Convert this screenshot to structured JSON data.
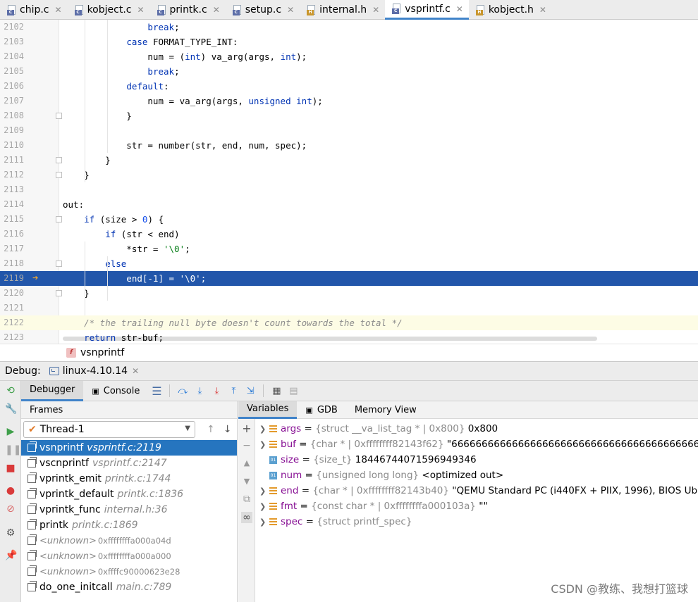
{
  "tabs": [
    {
      "label": "chip.c",
      "kind": "c"
    },
    {
      "label": "kobject.c",
      "kind": "c"
    },
    {
      "label": "printk.c",
      "kind": "c"
    },
    {
      "label": "setup.c",
      "kind": "c"
    },
    {
      "label": "internal.h",
      "kind": "h"
    },
    {
      "label": "vsprintf.c",
      "kind": "c",
      "active": true
    },
    {
      "label": "kobject.h",
      "kind": "h"
    }
  ],
  "code_lines": [
    {
      "num": "2102",
      "text": "                break;"
    },
    {
      "num": "2103",
      "text": "            case FORMAT_TYPE_INT:"
    },
    {
      "num": "2104",
      "text": "                num = (int) va_arg(args, int);"
    },
    {
      "num": "2105",
      "text": "                break;"
    },
    {
      "num": "2106",
      "text": "            default:"
    },
    {
      "num": "2107",
      "text": "                num = va_arg(args, unsigned int);"
    },
    {
      "num": "2108",
      "text": "            }"
    },
    {
      "num": "2109",
      "text": ""
    },
    {
      "num": "2110",
      "text": "            str = number(str, end, num, spec);"
    },
    {
      "num": "2111",
      "text": "        }"
    },
    {
      "num": "2112",
      "text": "    }"
    },
    {
      "num": "2113",
      "text": ""
    },
    {
      "num": "2114",
      "text": "out:"
    },
    {
      "num": "2115",
      "text": "    if (size > 0) {"
    },
    {
      "num": "2116",
      "text": "        if (str < end)"
    },
    {
      "num": "2117",
      "text": "            *str = '\\0';"
    },
    {
      "num": "2118",
      "text": "        else"
    },
    {
      "num": "2119",
      "text": "            end[-1] = '\\0';"
    },
    {
      "num": "2120",
      "text": "    }"
    },
    {
      "num": "2121",
      "text": ""
    },
    {
      "num": "2122",
      "text": "    /* the trailing null byte doesn't count towards the total */"
    },
    {
      "num": "2123",
      "text": "    return str-buf;"
    }
  ],
  "breadcrumb": {
    "function": "vsnprintf",
    "badge": "f"
  },
  "debug": {
    "label": "Debug:",
    "session": "linux-4.10.14",
    "tabs": {
      "debugger": "Debugger",
      "console": "Console"
    },
    "frames_title": "Frames",
    "thread": "Thread-1",
    "frames": [
      {
        "fn": "vsnprintf",
        "loc": "vsprintf.c:2119"
      },
      {
        "fn": "vscnprintf",
        "loc": "vsprintf.c:2147"
      },
      {
        "fn": "vprintk_emit",
        "loc": "printk.c:1744"
      },
      {
        "fn": "vprintk_default",
        "loc": "printk.c:1836"
      },
      {
        "fn": "vprintk_func",
        "loc": "internal.h:36"
      },
      {
        "fn": "printk",
        "loc": "printk.c:1869"
      },
      {
        "fn": "<unknown>",
        "addr": "0xffffffffa000a04d"
      },
      {
        "fn": "<unknown>",
        "addr": "0xffffffffa000a000"
      },
      {
        "fn": "<unknown>",
        "addr": "0xffffc90000623e28"
      },
      {
        "fn": "do_one_initcall",
        "loc": "main.c:789"
      }
    ],
    "var_tabs": {
      "variables": "Variables",
      "gdb": "GDB",
      "memory": "Memory View"
    },
    "variables": [
      {
        "name": "args",
        "type": "{struct __va_list_tag * | 0x800}",
        "value": "0x800",
        "expandable": true,
        "icon": "field"
      },
      {
        "name": "buf",
        "type": "{char * | 0xffffffff82143f62}",
        "value": "\"6666666666666666666666666666666666666666666666",
        "expandable": true,
        "icon": "field"
      },
      {
        "name": "size",
        "type": "{size_t}",
        "value": "18446744071596949346",
        "expandable": false,
        "icon": "prim"
      },
      {
        "name": "num",
        "type": "{unsigned long long}",
        "value": "<optimized out>",
        "expandable": false,
        "icon": "prim"
      },
      {
        "name": "end",
        "type": "{char * | 0xffffffff82143b40}",
        "value": "\"QEMU Standard PC (i440FX + PIIX, 1996), BIOS Ubun",
        "expandable": true,
        "icon": "field"
      },
      {
        "name": "fmt",
        "type": "{const char * | 0xffffffffa000103a}",
        "value": "\"\"",
        "expandable": true,
        "icon": "field"
      },
      {
        "name": "spec",
        "type": "{struct printf_spec}",
        "value": "",
        "expandable": true,
        "icon": "field"
      }
    ]
  },
  "watermark": "CSDN @教练、我想打篮球",
  "colors": {
    "accent": "#4083c9",
    "exec_line": "#2256aa",
    "selected_frame": "#2675bf",
    "keyword": "#0033b3"
  }
}
